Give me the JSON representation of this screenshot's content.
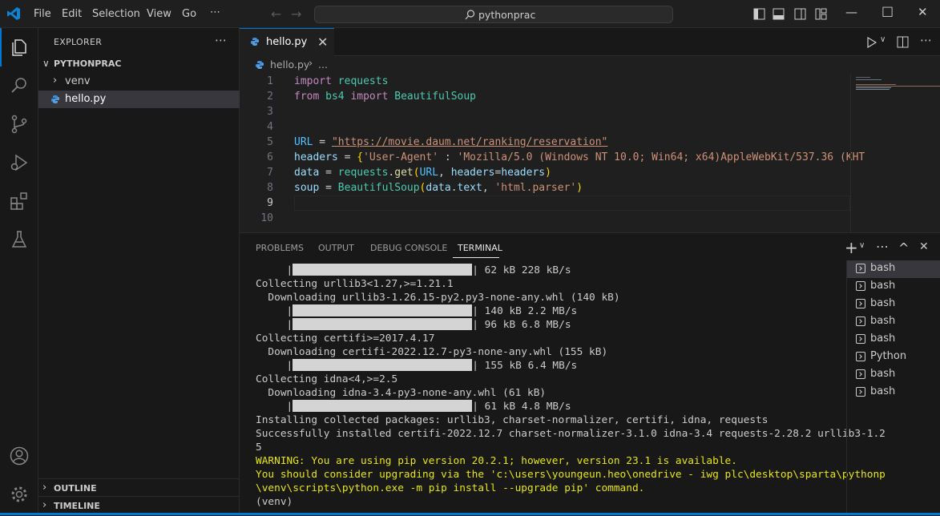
{
  "titlebar": {
    "menu": [
      "File",
      "Edit",
      "Selection",
      "View",
      "Go",
      "⋯"
    ],
    "search_text": "pythonprac",
    "icons": [
      "vscode-logo-icon",
      "arrow-left-icon",
      "arrow-right-icon",
      "search-icon",
      "toggle-sidebar-icon",
      "toggle-panel-icon",
      "toggle-secondary-sidebar-icon",
      "customize-layout-icon",
      "minimize-icon",
      "maximize-icon",
      "close-icon"
    ]
  },
  "activitybar": {
    "items": [
      "explorer",
      "search",
      "source-control",
      "run-and-debug",
      "extensions",
      "testing"
    ],
    "bottom": [
      "accounts",
      "manage"
    ]
  },
  "sidebar": {
    "title": "EXPLORER",
    "more": "⋯",
    "root": "PYTHONPRAC",
    "items": [
      {
        "label": "venv",
        "type": "folder"
      },
      {
        "label": "hello.py",
        "type": "python-file"
      }
    ],
    "outline": "OUTLINE",
    "timeline": "TIMELINE"
  },
  "editor": {
    "tab_label": "hello.py",
    "breadcrumb_file": "hello.py",
    "breadcrumb_more": "...",
    "line_numbers": [
      "1",
      "2",
      "3",
      "4",
      "5",
      "6",
      "7",
      "8",
      "9",
      "10"
    ],
    "lines": [
      [
        "import",
        " ",
        "requests"
      ],
      [
        "from",
        " ",
        "bs4",
        " ",
        "import",
        " ",
        "BeautifulSoup"
      ],
      [],
      [],
      [
        "URL",
        " = ",
        "\"https://movie.daum.net/ranking/reservation\""
      ],
      [
        "headers",
        " = ",
        "{",
        "'User-Agent'",
        " : ",
        "'Mozilla/5.0 (Windows NT 10.0; Win64; x64)AppleWebKit/537.36 (KHT"
      ],
      [
        "data",
        " = ",
        "requests",
        ".",
        "get",
        "(",
        "URL",
        ", ",
        "headers",
        "=",
        "headers",
        ")"
      ],
      [
        "soup",
        " = ",
        "BeautifulSoup",
        "(",
        "data",
        ".",
        "text",
        ", ",
        "'html.parser'",
        ")"
      ],
      [],
      []
    ]
  },
  "panel": {
    "tabs": [
      "PROBLEMS",
      "OUTPUT",
      "DEBUG CONSOLE",
      "TERMINAL"
    ],
    "active_tab": "TERMINAL",
    "actions": [
      "+",
      "⋯",
      "^",
      "✕"
    ],
    "terminal_lines": [
      {
        "bar": true,
        "text": " 62 kB 228 kB/s"
      },
      {
        "text": "Collecting urllib3<1.27,>=1.21.1"
      },
      {
        "text": "  Downloading urllib3-1.26.15-py2.py3-none-any.whl (140 kB)"
      },
      {
        "bar": true,
        "text": " 140 kB 2.2 MB/s"
      },
      {
        "bar": true,
        "text": " 96 kB 6.8 MB/s"
      },
      {
        "text": "Collecting certifi>=2017.4.17"
      },
      {
        "text": "  Downloading certifi-2022.12.7-py3-none-any.whl (155 kB)"
      },
      {
        "bar": true,
        "text": " 155 kB 6.4 MB/s"
      },
      {
        "text": "Collecting idna<4,>=2.5"
      },
      {
        "text": "  Downloading idna-3.4-py3-none-any.whl (61 kB)"
      },
      {
        "bar": true,
        "text": " 61 kB 4.8 MB/s"
      },
      {
        "text": "Installing collected packages: urllib3, charset-normalizer, certifi, idna, requests"
      },
      {
        "text": "Successfully installed certifi-2022.12.7 charset-normalizer-3.1.0 idna-3.4 requests-2.28.2 urllib3-1.2"
      },
      {
        "text": "5"
      },
      {
        "warn": true,
        "text": "WARNING: You are using pip version 20.2.1; however, version 23.1 is available."
      },
      {
        "warn": true,
        "text": "You should consider upgrading via the 'c:\\users\\youngeun.heo\\onedrive - iwg plc\\desktop\\sparta\\pythonp"
      },
      {
        "warn": true,
        "text": "\\venv\\scripts\\python.exe -m pip install --upgrade pip' command."
      },
      {
        "text": "(venv)"
      }
    ],
    "terminals": [
      "bash",
      "bash",
      "bash",
      "bash",
      "bash",
      "Python",
      "bash",
      "bash"
    ]
  },
  "colors": {
    "accent": "#0078d4",
    "warning": "#e5e510",
    "keyword": "#c586c0",
    "class": "#4ec9b0",
    "string": "#ce9178"
  }
}
